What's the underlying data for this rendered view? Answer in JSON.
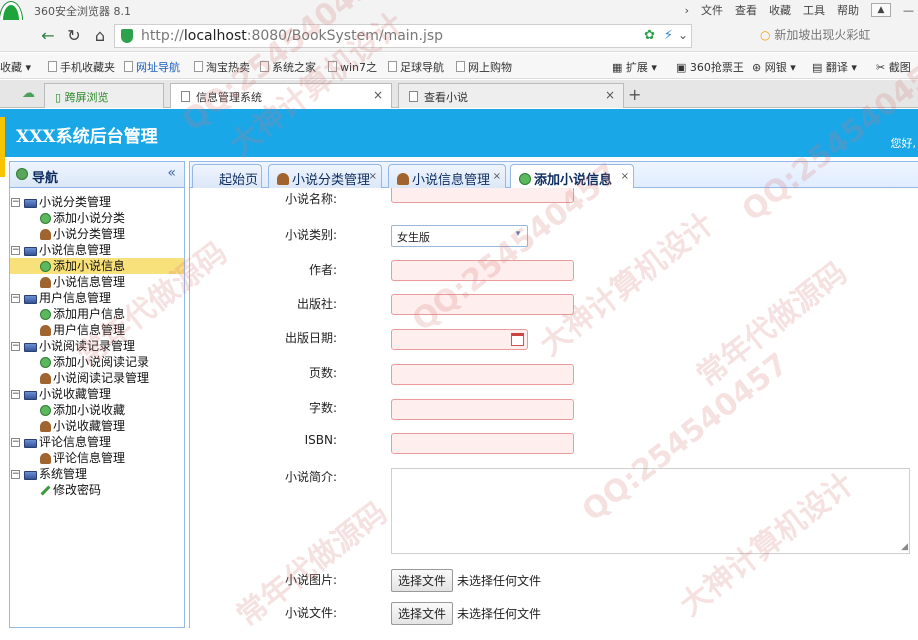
{
  "browser": {
    "window_title": "360安全浏览器 8.1",
    "menu": [
      "文件",
      "查看",
      "收藏",
      "工具",
      "帮助"
    ],
    "url_host": "localhost",
    "url_rest": ":8080/BookSystem/main.jsp",
    "url_prefix": "http://",
    "search_text": "新加坡出现火彩虹",
    "favorites": [
      "收藏",
      "手机收藏夹",
      "网址导航",
      "淘宝热卖",
      "系统之家",
      "win7之",
      "足球导航",
      "网上购物"
    ],
    "extras": [
      "扩展",
      "360抢票王",
      "网银",
      "翻译",
      "截图"
    ],
    "tabs": [
      {
        "label": "跨屏浏览"
      },
      {
        "label": "信息管理系统"
      },
      {
        "label": "查看小说"
      }
    ]
  },
  "app": {
    "title": "XXX系统后台管理",
    "greeting": "您好,"
  },
  "sidebar": {
    "title": "导航",
    "collapse": "«",
    "tree": [
      {
        "label": "小说分类管理",
        "level": 0,
        "icon": "computer-icon"
      },
      {
        "label": "添加小说分类",
        "level": 1,
        "icon": "add-icon"
      },
      {
        "label": "小说分类管理",
        "level": 1,
        "icon": "user-icon"
      },
      {
        "label": "小说信息管理",
        "level": 0,
        "icon": "computer-icon"
      },
      {
        "label": "添加小说信息",
        "level": 1,
        "icon": "add-icon",
        "selected": true
      },
      {
        "label": "小说信息管理",
        "level": 1,
        "icon": "user-icon"
      },
      {
        "label": "用户信息管理",
        "level": 0,
        "icon": "computer-icon"
      },
      {
        "label": "添加用户信息",
        "level": 1,
        "icon": "add-icon"
      },
      {
        "label": "用户信息管理",
        "level": 1,
        "icon": "user-icon"
      },
      {
        "label": "小说阅读记录管理",
        "level": 0,
        "icon": "computer-icon"
      },
      {
        "label": "添加小说阅读记录",
        "level": 1,
        "icon": "add-icon"
      },
      {
        "label": "小说阅读记录管理",
        "level": 1,
        "icon": "user-icon"
      },
      {
        "label": "小说收藏管理",
        "level": 0,
        "icon": "computer-icon"
      },
      {
        "label": "添加小说收藏",
        "level": 1,
        "icon": "add-icon"
      },
      {
        "label": "小说收藏管理",
        "level": 1,
        "icon": "user-icon"
      },
      {
        "label": "评论信息管理",
        "level": 0,
        "icon": "computer-icon"
      },
      {
        "label": "评论信息管理",
        "level": 1,
        "icon": "user-icon"
      },
      {
        "label": "系统管理",
        "level": 0,
        "icon": "computer-icon"
      },
      {
        "label": "修改密码",
        "level": 1,
        "icon": "pencil-icon"
      }
    ]
  },
  "content_tabs": [
    {
      "label": "起始页",
      "closable": false
    },
    {
      "label": "小说分类管理",
      "closable": true,
      "icon": "user-icon"
    },
    {
      "label": "小说信息管理",
      "closable": true,
      "icon": "user-icon"
    },
    {
      "label": "添加小说信息",
      "closable": true,
      "icon": "add-icon",
      "active": true
    }
  ],
  "form": {
    "name_label": "小说名称:",
    "category_label": "小说类别:",
    "category_value": "女生版",
    "author_label": "作者:",
    "publisher_label": "出版社:",
    "date_label": "出版日期:",
    "pages_label": "页数:",
    "words_label": "字数:",
    "isbn_label": "ISBN:",
    "intro_label": "小说简介:",
    "image_label": "小说图片:",
    "file_label": "小说文件:",
    "choose_file": "选择文件",
    "no_file": "未选择任何文件"
  },
  "watermarks": [
    "QQ:254540457",
    "大神计算机设计",
    "常年代做源码",
    "QQ:254540457",
    "大神计算机设计",
    "常年代做源码",
    "QQ:254540457",
    "大神计算机设计",
    "常年代做源码",
    "QQ:254540457"
  ]
}
